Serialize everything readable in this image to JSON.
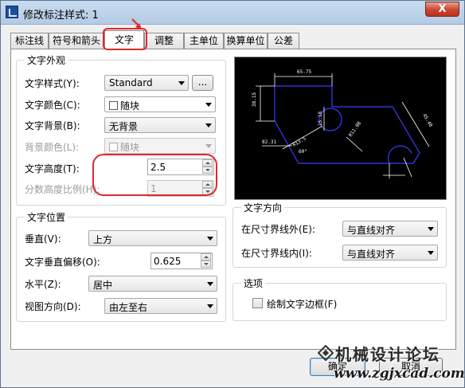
{
  "window": {
    "title": "修改标注样式: 1",
    "close_glyph": "X"
  },
  "tabs": [
    {
      "label": "标注线"
    },
    {
      "label": "符号和箭头"
    },
    {
      "label": "文字"
    },
    {
      "label": "调整"
    },
    {
      "label": "主单位"
    },
    {
      "label": "换算单位"
    },
    {
      "label": "公差"
    }
  ],
  "active_tab": "文字",
  "text_appearance": {
    "title": "文字外观",
    "style_label": "文字样式(Y):",
    "style_value": "Standard",
    "style_browse": "...",
    "color_label": "文字颜色(C):",
    "color_value": "随块",
    "fill_label": "文字背景(B):",
    "fill_value": "无背景",
    "bgcolor_label": "背景颜色(L):",
    "bgcolor_value": "随块",
    "height_label": "文字高度(T):",
    "height_value": "2.5",
    "fraction_label": "分数高度比例(H):",
    "fraction_value": "1"
  },
  "text_placement": {
    "title": "文字位置",
    "vertical_label": "垂直(V):",
    "vertical_value": "上方",
    "offset_label": "文字垂直偏移(O):",
    "offset_value": "0.625",
    "horizontal_label": "水平(Z):",
    "horizontal_value": "居中",
    "view_label": "视图方向(D):",
    "view_value": "由左至右"
  },
  "text_alignment": {
    "title": "文字方向",
    "outside_label": "在尺寸界线外(E):",
    "outside_value": "与直线对齐",
    "inside_label": "在尺寸界线内(I):",
    "inside_value": "与直线对齐"
  },
  "options": {
    "title": "选项",
    "frame_label": "绘制文字边框(F)",
    "frame_checked": false
  },
  "preview": {
    "dim_top": "65.75",
    "dim_left": "38.15",
    "dim_right": "45.48",
    "dim_mid": "15.18",
    "radius_left": "R13.5",
    "radius_right": "R11.08",
    "dim_bottom_left": "82.31",
    "angle": "60°"
  },
  "buttons": {
    "ok": "确定",
    "cancel": "取消"
  },
  "watermark": {
    "title": "机械设计论坛",
    "url": "www.zgjxcad.com"
  },
  "colors": {
    "highlight": "#e02a2a",
    "preview_bg": "#000000",
    "preview_lines": "#3a3aff",
    "preview_text": "#ffffff"
  }
}
